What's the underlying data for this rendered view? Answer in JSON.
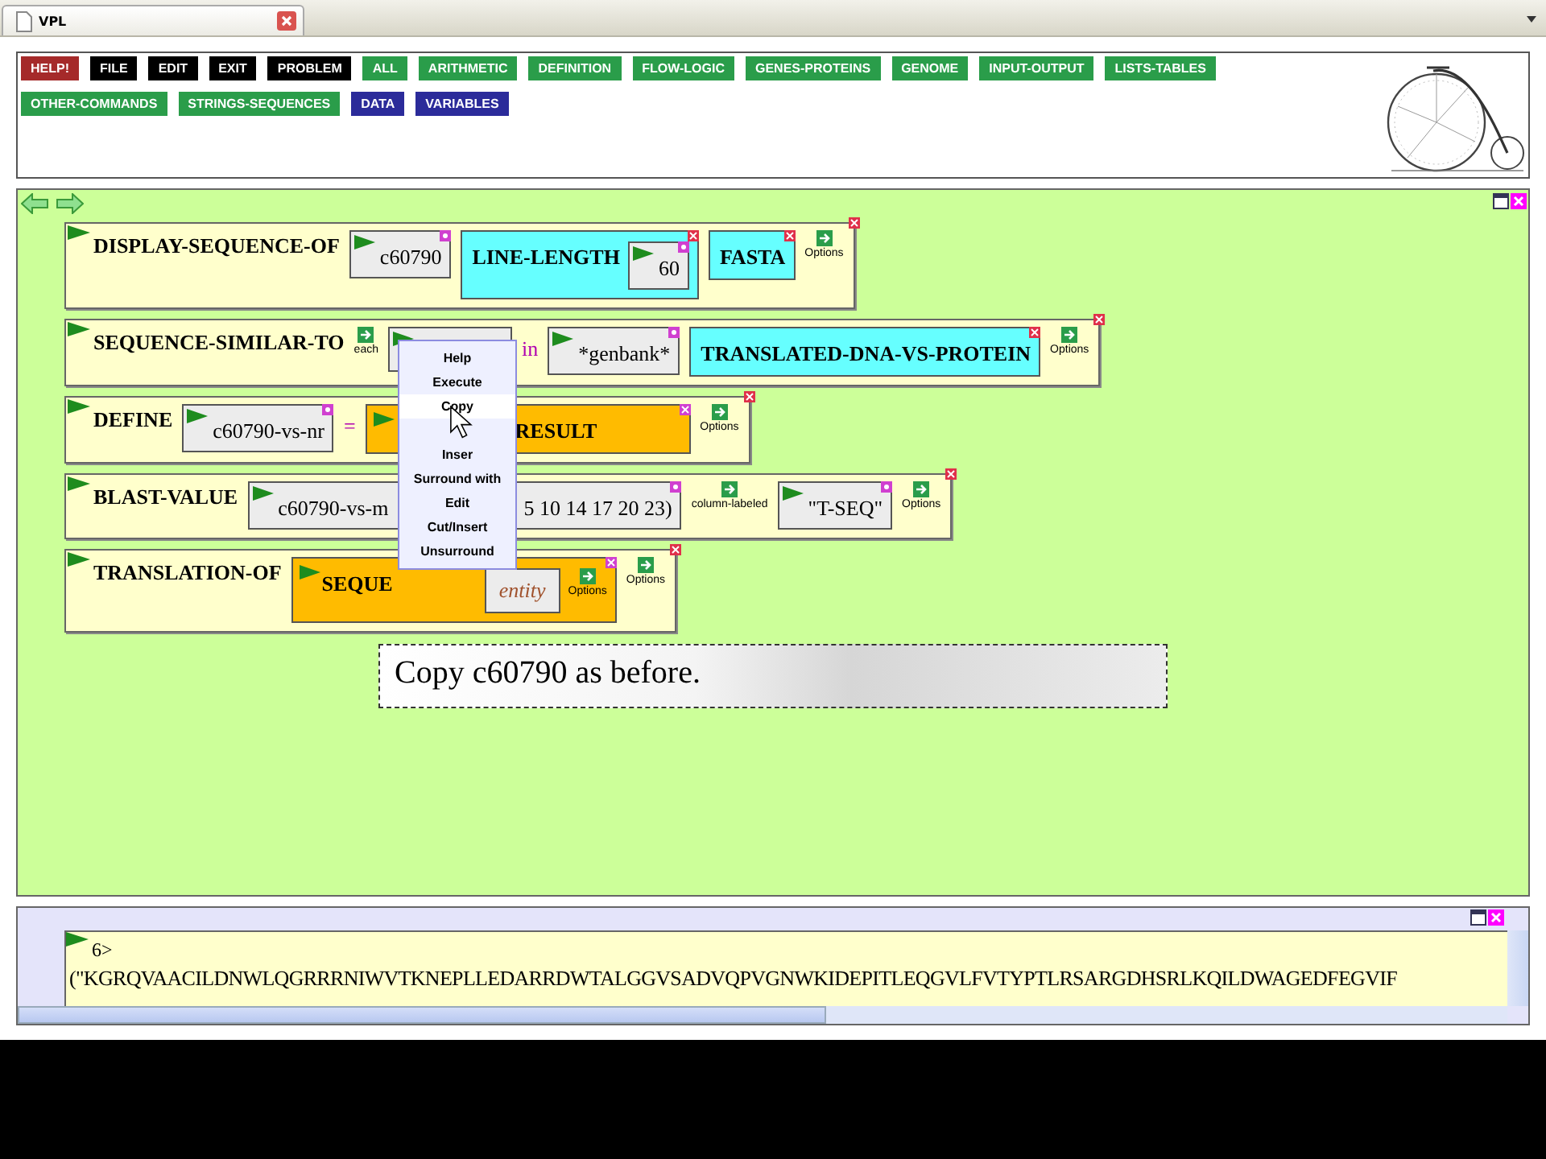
{
  "browser_tab": {
    "title": "VPL"
  },
  "toolbar": {
    "buttons": [
      {
        "label": "HELP!",
        "color": "#a52a2a"
      },
      {
        "label": "FILE",
        "color": "#000000"
      },
      {
        "label": "EDIT",
        "color": "#000000"
      },
      {
        "label": "EXIT",
        "color": "#000000"
      },
      {
        "label": "PROBLEM",
        "color": "#000000"
      },
      {
        "label": "ALL",
        "color": "#2a9d4a"
      },
      {
        "label": "ARITHMETIC",
        "color": "#2a9d4a"
      },
      {
        "label": "DEFINITION",
        "color": "#2a9d4a"
      },
      {
        "label": "FLOW-LOGIC",
        "color": "#2a9d4a"
      },
      {
        "label": "GENES-PROTEINS",
        "color": "#2a9d4a"
      },
      {
        "label": "GENOME",
        "color": "#2a9d4a"
      },
      {
        "label": "INPUT-OUTPUT",
        "color": "#2a9d4a"
      },
      {
        "label": "LISTS-TABLES",
        "color": "#2a9d4a"
      },
      {
        "label": "OTHER-COMMANDS",
        "color": "#2a9d4a"
      },
      {
        "label": "STRINGS-SEQUENCES",
        "color": "#2a9d4a"
      },
      {
        "label": "DATA",
        "color": "#2b2b9a"
      },
      {
        "label": "VARIABLES",
        "color": "#2b2b9a"
      }
    ]
  },
  "workspace": {
    "blocks": [
      {
        "title": "DISPLAY-SEQUENCE-OF",
        "parts": [
          {
            "kind": "arg",
            "text": "c60790"
          },
          {
            "kind": "keyword",
            "text": "LINE-LENGTH",
            "children": [
              {
                "kind": "arg",
                "text": "60"
              }
            ]
          },
          {
            "kind": "keyword",
            "text": "FASTA"
          },
          {
            "kind": "option",
            "text": "Options"
          }
        ]
      },
      {
        "title": "SEQUENCE-SIMILAR-TO",
        "parts": [
          {
            "kind": "option",
            "text": "each"
          },
          {
            "kind": "covered"
          },
          {
            "kind": "word",
            "text": "in"
          },
          {
            "kind": "arg",
            "text": "*genbank*"
          },
          {
            "kind": "keyword",
            "text": "TRANSLATED-DNA-VS-PROTEIN"
          },
          {
            "kind": "option",
            "text": "Options"
          }
        ]
      },
      {
        "title": "DEFINE",
        "parts": [
          {
            "kind": "arg",
            "text": "c60790-vs-nr"
          },
          {
            "kind": "word",
            "text": "="
          },
          {
            "kind": "call",
            "text": "RESULT",
            "covered_start": true
          },
          {
            "kind": "option",
            "text": "Options"
          }
        ]
      },
      {
        "title": "BLAST-VALUE",
        "parts": [
          {
            "kind": "split",
            "texts": [
              "c60790-vs-m",
              "5 10 14 17 20 23)"
            ]
          },
          {
            "kind": "option",
            "text": "column-labeled"
          },
          {
            "kind": "arg",
            "text": "\"T-SEQ\""
          },
          {
            "kind": "option",
            "text": "Options"
          }
        ]
      },
      {
        "title": "TRANSLATION-OF",
        "parts": [
          {
            "kind": "call",
            "text": "SEQUE",
            "children": [
              {
                "kind": "arg",
                "text": "entity",
                "italic": true
              },
              {
                "kind": "option",
                "text": "Options"
              }
            ]
          },
          {
            "kind": "option",
            "text": "Options"
          }
        ]
      }
    ],
    "context_menu": {
      "items": [
        {
          "label": "Help",
          "selected": false
        },
        {
          "label": "Execute",
          "selected": false
        },
        {
          "label": "Copy",
          "selected": true
        },
        {
          "label": "Inser",
          "selected": false
        },
        {
          "label": "Surround with",
          "selected": false
        },
        {
          "label": "Edit",
          "selected": false
        },
        {
          "label": "Cut/Insert",
          "selected": false
        },
        {
          "label": "Unsurround",
          "selected": false
        }
      ]
    },
    "tooltip": "Copy c60790 as before."
  },
  "output": {
    "prompt": "6>",
    "result": "(\"KGRQVAACILDNWLQGRRRNIWVTKNEPLLEDARRDWTALGGVSADVQPVGNWKIDEPITLEQGVLFVTYPTLRSARGDHSRLKQILDWAGEDFEGVIF"
  }
}
